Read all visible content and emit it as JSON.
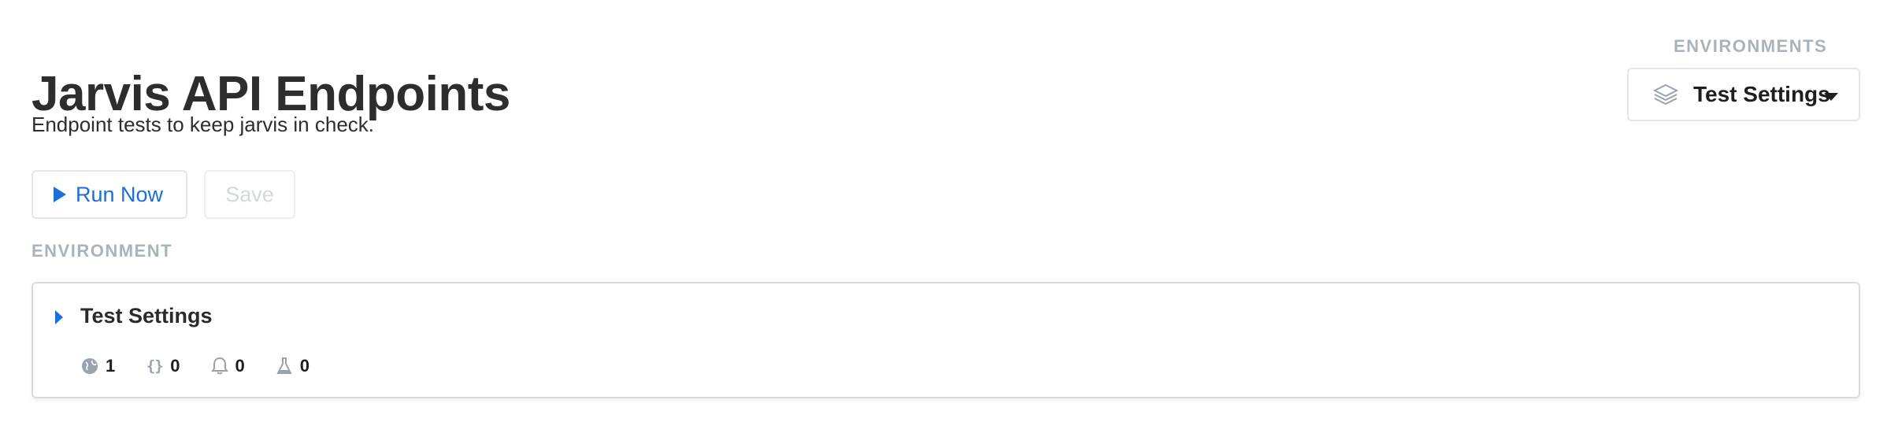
{
  "header": {
    "title": "Jarvis API Endpoints",
    "description": "Endpoint tests to keep jarvis in check."
  },
  "toolbar": {
    "run_label": "Run Now",
    "save_label": "Save"
  },
  "environments_select": {
    "label": "ENVIRONMENTS",
    "selected": "Test Settings",
    "icon": "layers-icon"
  },
  "environment_section": {
    "label": "ENVIRONMENT",
    "name": "Test Settings",
    "stats": [
      {
        "icon": "globe-icon",
        "count": "1"
      },
      {
        "icon": "braces-icon",
        "count": "0"
      },
      {
        "icon": "bell-icon",
        "count": "0"
      },
      {
        "icon": "flask-icon",
        "count": "0"
      }
    ]
  },
  "colors": {
    "accent": "#1c6fd6",
    "muted_label": "#aab3bc",
    "border": "#e3e6ea"
  }
}
